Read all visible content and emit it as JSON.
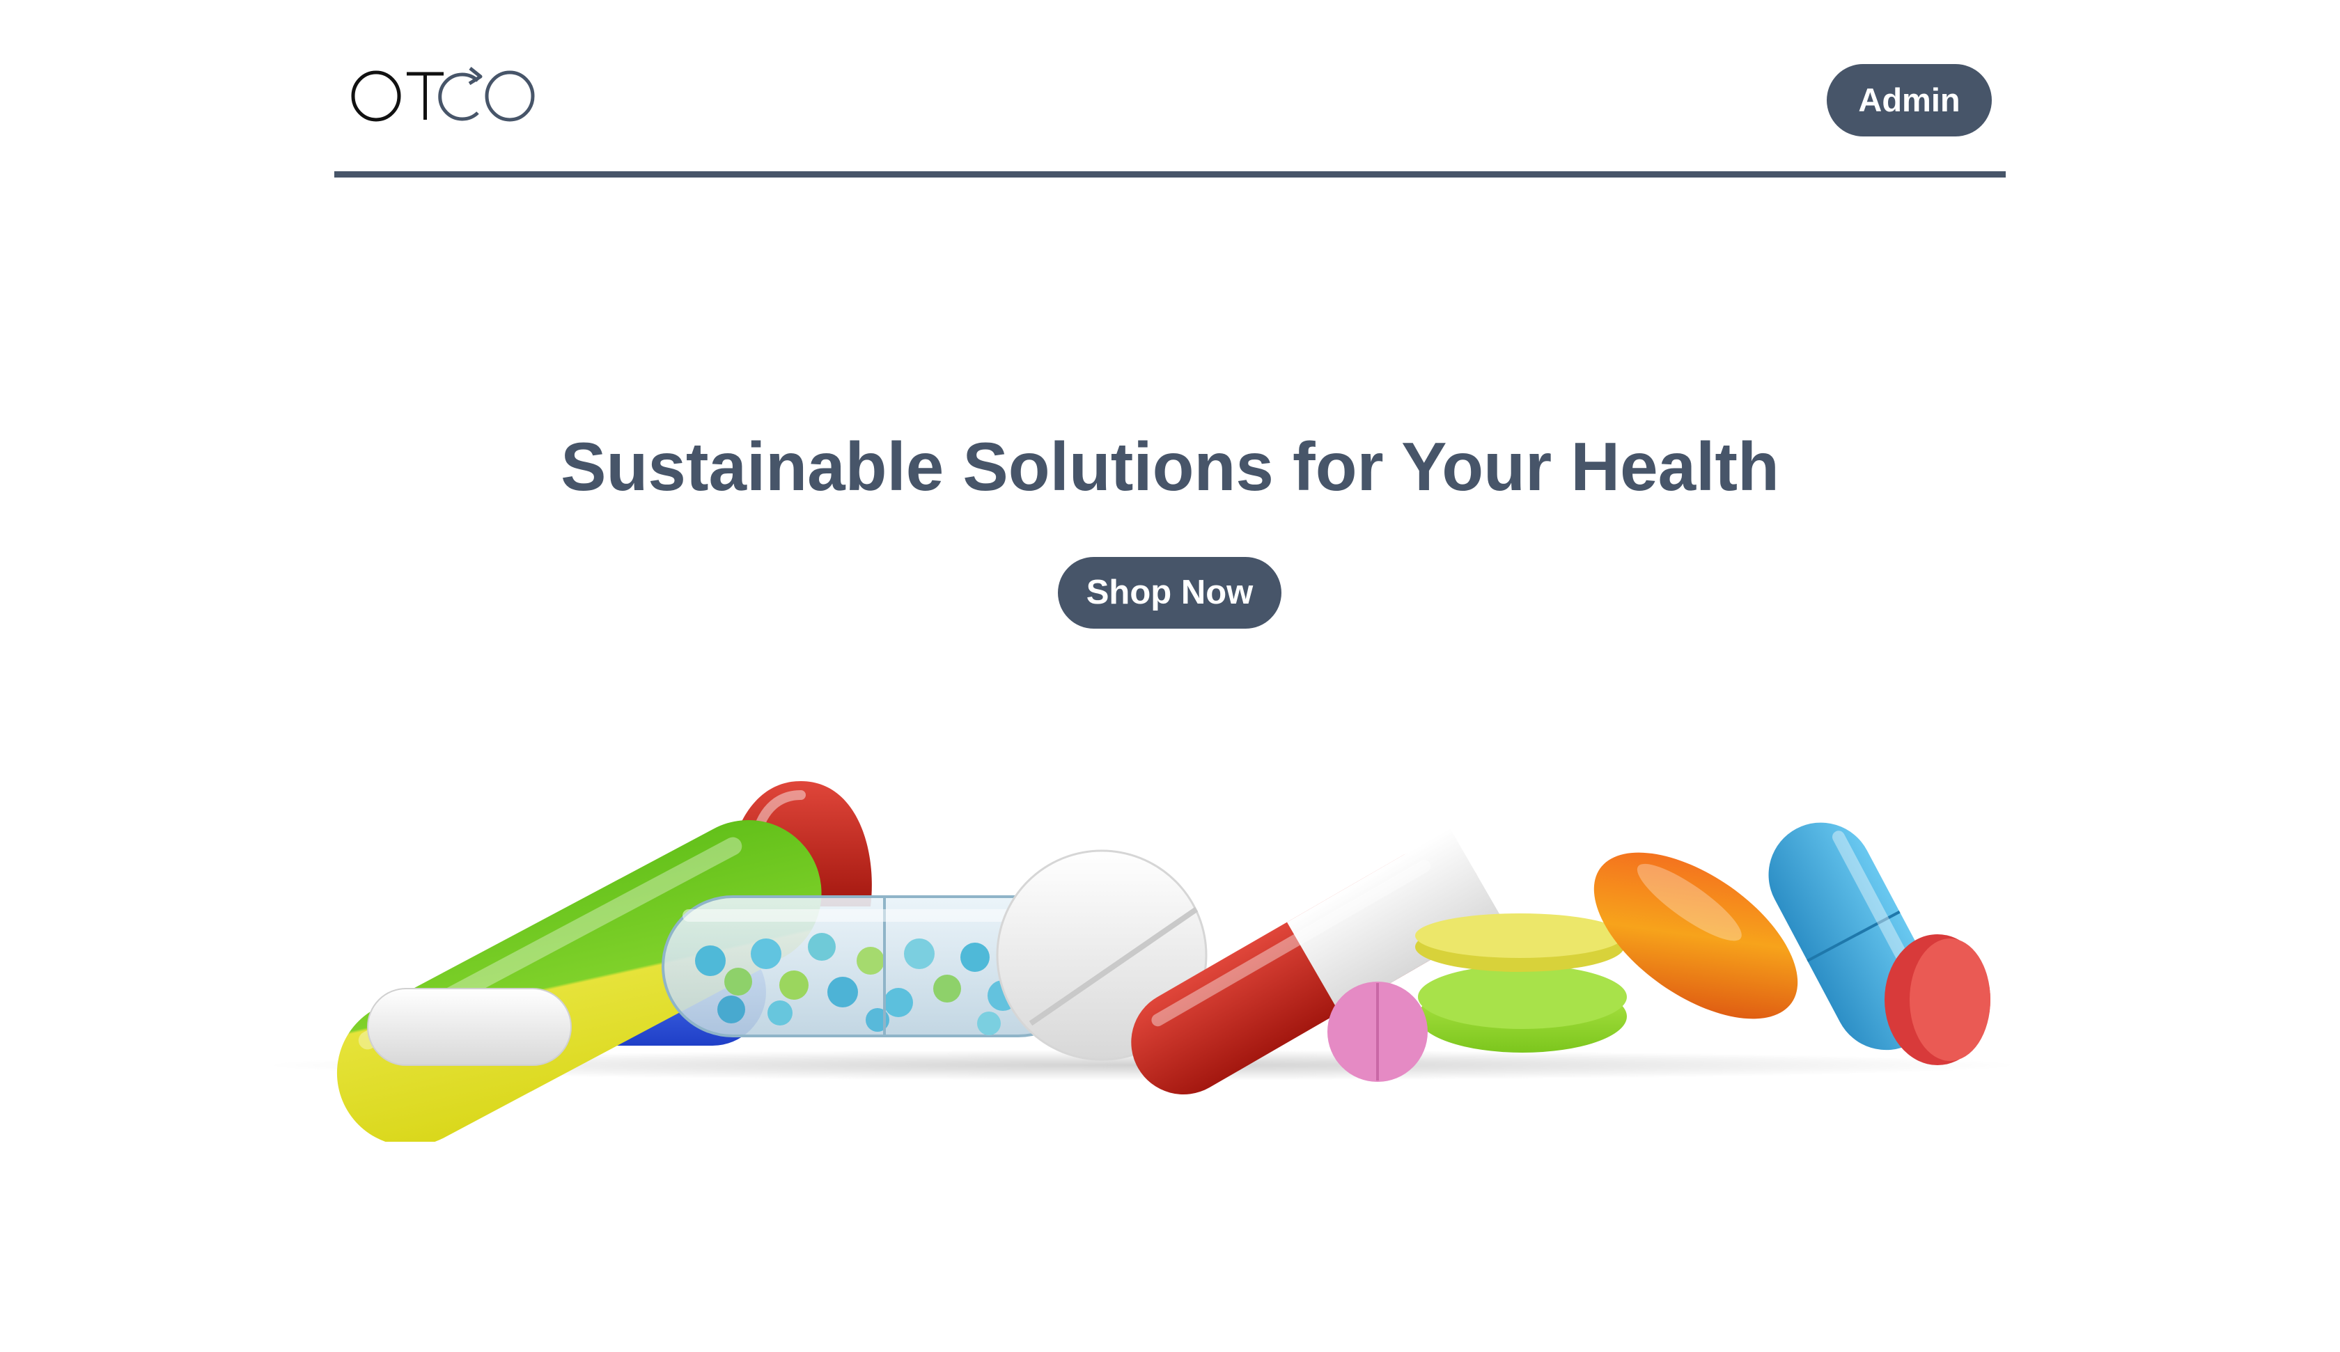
{
  "header": {
    "logo_text": "OTCO",
    "admin_label": "Admin"
  },
  "hero": {
    "title": "Sustainable Solutions for Your Health",
    "cta_label": "Shop Now",
    "image_semantic": "pills-and-capsules-image"
  },
  "colors": {
    "brand": "#475569",
    "background": "#ffffff",
    "button_text": "#ffffff"
  }
}
